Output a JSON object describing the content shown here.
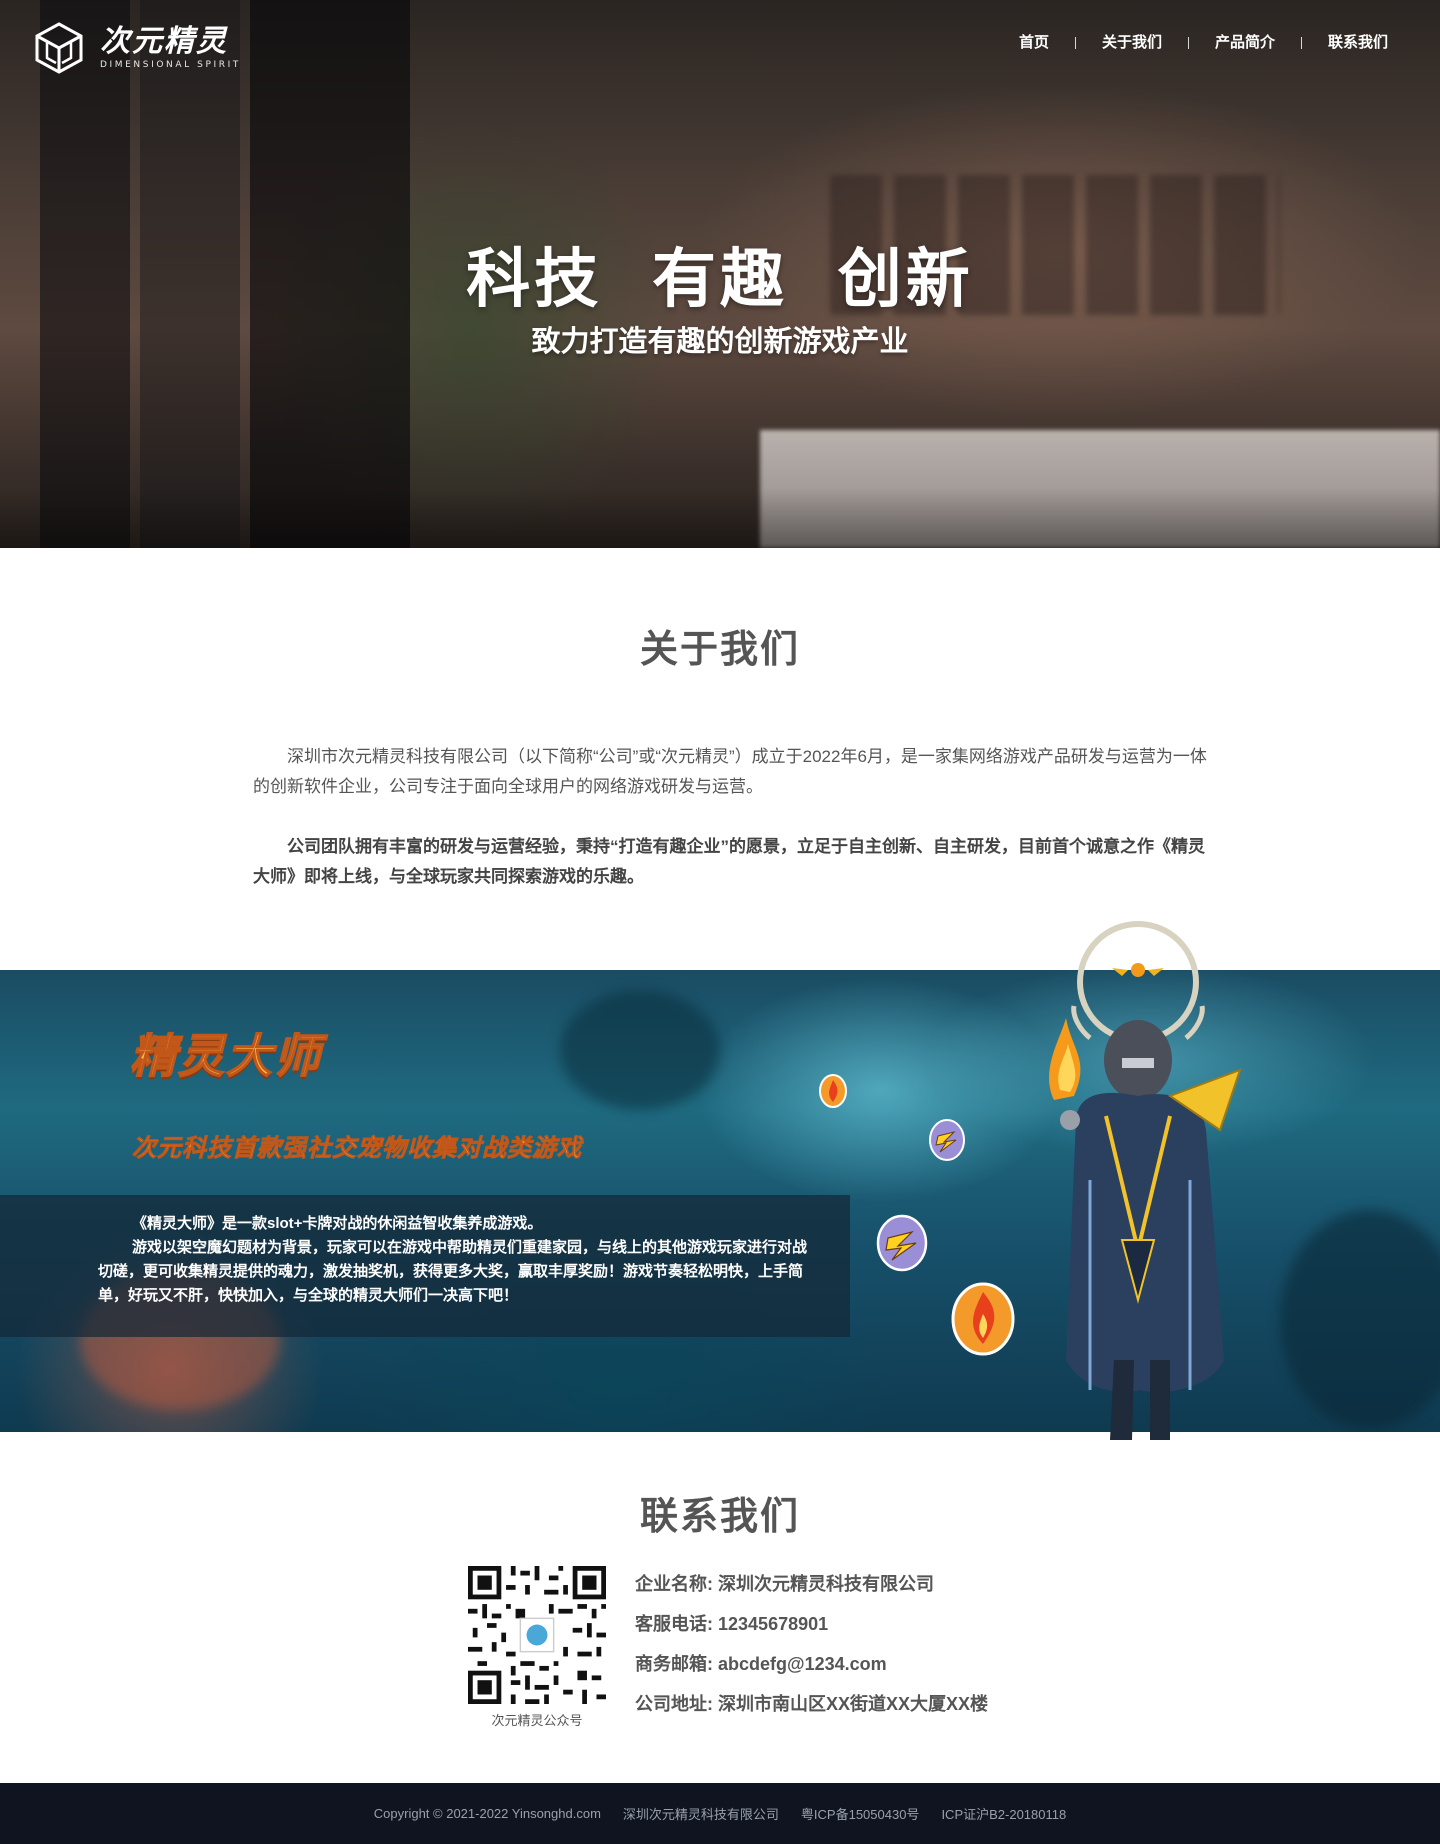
{
  "header": {
    "logo_cn": "次元精灵",
    "logo_en": "DIMENSIONAL SPIRIT",
    "nav": [
      "首页",
      "关于我们",
      "产品简介",
      "联系我们"
    ]
  },
  "hero": {
    "title": "科技 有趣 创新",
    "subtitle": "致力打造有趣的创新游戏产业"
  },
  "about": {
    "title": "关于我们",
    "paragraph1": "深圳市次元精灵科技有限公司（以下简称“公司”或“次元精灵”）成立于2022年6月，是一家集网络游戏产品研发与运营为一体的创新软件企业，公司专注于面向全球用户的网络游戏研发与运营。",
    "paragraph2": "公司团队拥有丰富的研发与运营经验，秉持“打造有趣企业”的愿景，立足于自主创新、自主研发，目前首个诚意之作《精灵大师》即将上线，与全球玩家共同探索游戏的乐趣。"
  },
  "game": {
    "title": "精灵大师",
    "tagline": "次元科技首款强社交宠物收集对战类游戏",
    "desc1": "《精灵大师》是一款slot+卡牌对战的休闲益智收集养成游戏。",
    "desc2": "游戏以架空魔幻题材为背景，玩家可以在游戏中帮助精灵们重建家园，与线上的其他游戏玩家进行对战切磋，更可收集精灵提供的魂力，激发抽奖机，获得更多大奖，赢取丰厚奖励！游戏节奏轻松明快，上手简单，好玩又不肝，快快加入，与全球的精灵大师们一决高下吧！"
  },
  "contact": {
    "title": "联系我们",
    "qr_caption": "次元精灵公众号",
    "rows": [
      {
        "label": "企业名称:",
        "value": "深圳次元精灵科技有限公司"
      },
      {
        "label": "客服电话:",
        "value": "12345678901"
      },
      {
        "label": "商务邮箱:",
        "value": "abcdefg@1234.com"
      },
      {
        "label": "公司地址:",
        "value": "深圳市南山区XX街道XX大厦XX楼"
      }
    ]
  },
  "footer": {
    "copyright": "Copyright © 2021-2022 Yinsonghd.com",
    "company": "深圳次元精灵科技有限公司",
    "icp1": "粤ICP备15050430号",
    "icp2": "ICP证沪B2-20180118"
  },
  "colors": {
    "footer_bg": "#0f1420",
    "game_title": "#ffb84a",
    "heading_gray": "#555555"
  }
}
